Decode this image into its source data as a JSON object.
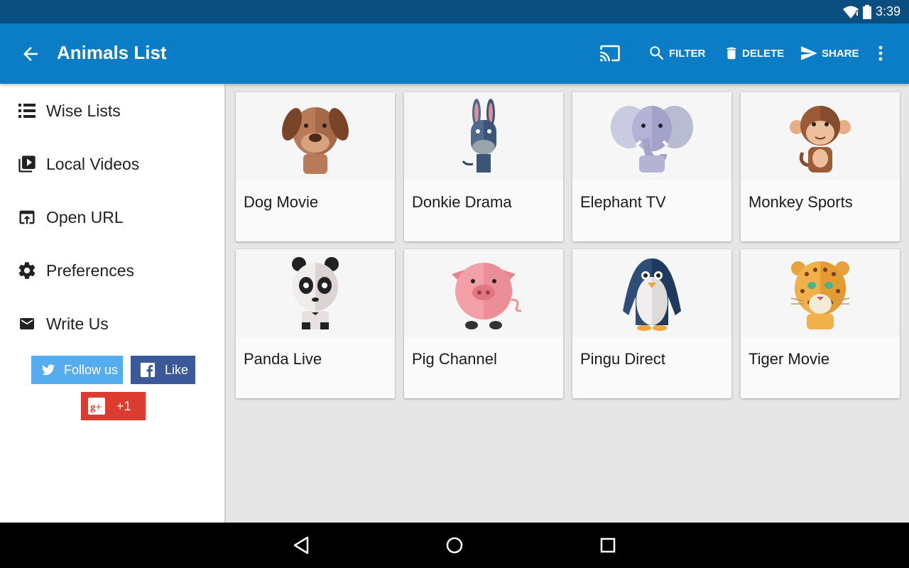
{
  "status": {
    "time": "3:39"
  },
  "appbar": {
    "title": "Animals List",
    "actions": {
      "filter": "FILTER",
      "delete": "DELETE",
      "share": "SHARE"
    }
  },
  "drawer": {
    "items": [
      {
        "label": "Wise Lists",
        "icon": "list-icon"
      },
      {
        "label": "Local Videos",
        "icon": "video-library-icon"
      },
      {
        "label": "Open URL",
        "icon": "open-in-browser-icon"
      },
      {
        "label": "Preferences",
        "icon": "gear-icon"
      },
      {
        "label": "Write Us",
        "icon": "mail-icon"
      }
    ],
    "social": {
      "twitter": "Follow us",
      "facebook": "Like",
      "google": "+1"
    }
  },
  "cards": [
    {
      "title": "Dog Movie",
      "icon": "dog-icon"
    },
    {
      "title": "Donkie Drama",
      "icon": "donkey-icon"
    },
    {
      "title": "Elephant TV",
      "icon": "elephant-icon"
    },
    {
      "title": "Monkey Sports",
      "icon": "monkey-icon"
    },
    {
      "title": "Panda Live",
      "icon": "panda-icon"
    },
    {
      "title": "Pig Channel",
      "icon": "pig-icon"
    },
    {
      "title": "Pingu Direct",
      "icon": "penguin-icon"
    },
    {
      "title": "Tiger Movie",
      "icon": "tiger-icon"
    }
  ],
  "colors": {
    "statusbar": "#0b4e80",
    "appbar": "#0b7dc6",
    "twitter": "#55acee",
    "facebook": "#3b5998",
    "google": "#dc3b2f"
  }
}
